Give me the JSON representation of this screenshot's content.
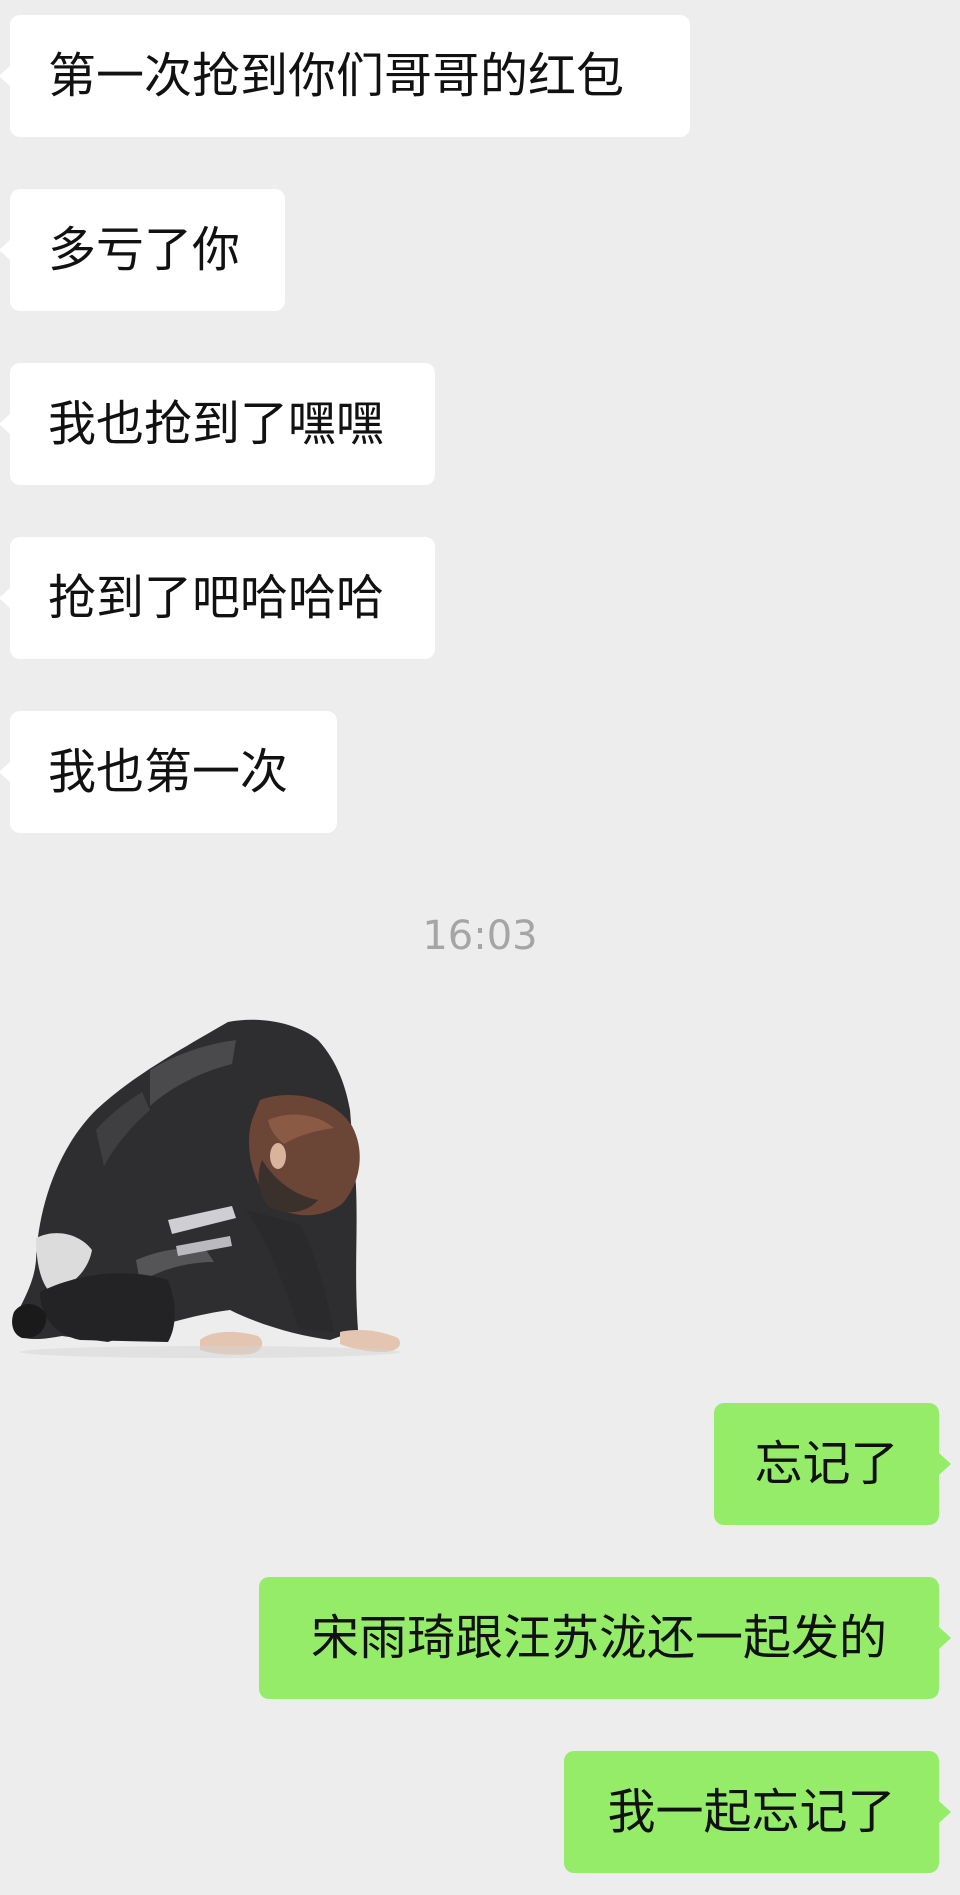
{
  "messages_incoming": [
    "第一次抢到你们哥哥的红包",
    "多亏了你",
    "我也抢到了嘿嘿",
    "抢到了吧哈哈哈",
    "我也第一次"
  ],
  "timestamp": "16:03",
  "sticker": {
    "icon": "kneeling-person-sticker-icon"
  },
  "messages_outgoing": [
    "忘记了",
    "宋雨琦跟汪苏泷还一起发的",
    "我一起忘记了"
  ],
  "colors": {
    "background": "#ededed",
    "incoming_bubble": "#ffffff",
    "outgoing_bubble": "#95ec69",
    "timestamp_text": "#a5a5a5"
  }
}
